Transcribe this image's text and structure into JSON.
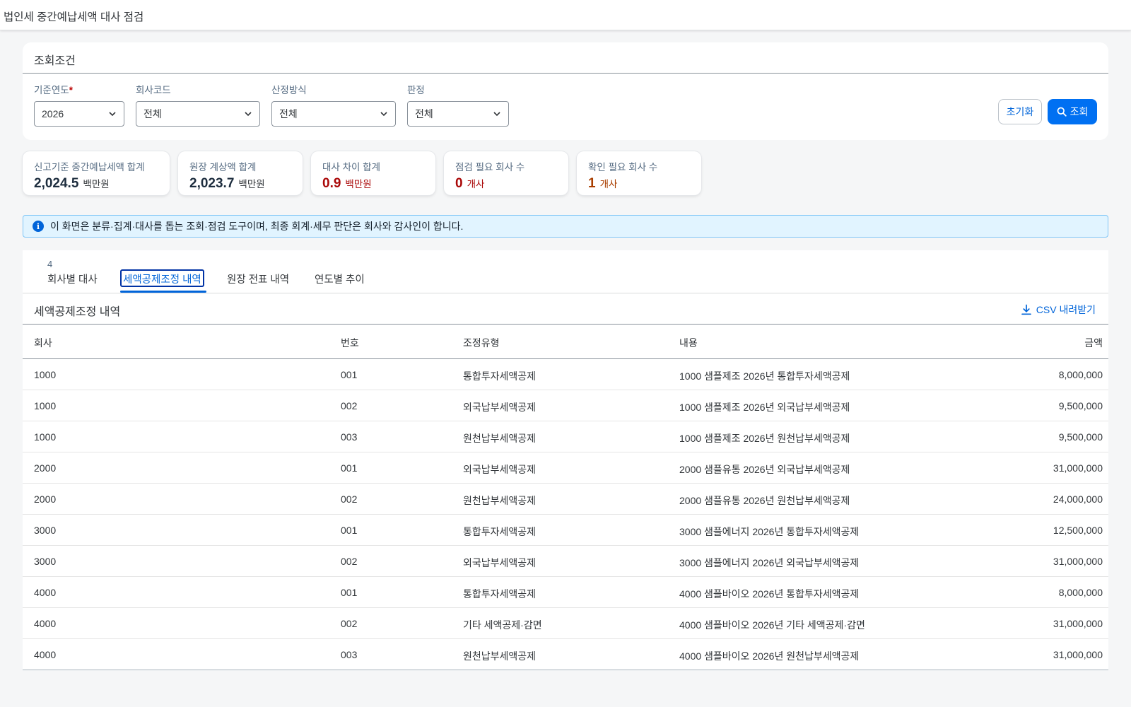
{
  "shell": {
    "title": "법인세 중간예납세액 대사 점검"
  },
  "filters": {
    "header": "조회조건",
    "year": {
      "label": "기준연도",
      "required_mark": "*",
      "value": "2026"
    },
    "company": {
      "label": "회사코드",
      "value": "전체"
    },
    "method": {
      "label": "산정방식",
      "value": "전체"
    },
    "verdict": {
      "label": "판정",
      "value": "전체"
    },
    "reset_label": "초기화",
    "search_label": "조회"
  },
  "kpis": [
    {
      "label": "신고기준 중간예납세액 합계",
      "value": "2,024.5",
      "unit": "백만원"
    },
    {
      "label": "원장 계상액 합계",
      "value": "2,023.7",
      "unit": "백만원"
    },
    {
      "label": "대사 차이 합계",
      "value": "0.9",
      "unit": "백만원"
    },
    {
      "label": "점검 필요 회사 수",
      "value": "0",
      "unit": "개사"
    },
    {
      "label": "확인 필요 회사 수",
      "value": "1",
      "unit": "개사"
    }
  ],
  "notice": "이 화면은 분류·집계·대사를 돕는 조회·점검 도구이며, 최종 회계·세무 판단은 회사와 감사인이 합니다.",
  "tabs": {
    "items": [
      {
        "label": "회사별 대사",
        "count": "4"
      },
      {
        "label": "세액공제조정 내역"
      },
      {
        "label": "원장 전표 내역"
      },
      {
        "label": "연도별 추이"
      }
    ],
    "active": "세액공제조정 내역"
  },
  "table": {
    "title": "세액공제조정 내역",
    "csv_label": "CSV 내려받기",
    "columns": [
      "회사",
      "번호",
      "조정유형",
      "내용",
      "금액"
    ],
    "rows": [
      [
        "1000",
        "001",
        "통합투자세액공제",
        "1000 샘플제조 2026년 통합투자세액공제",
        "8,000,000"
      ],
      [
        "1000",
        "002",
        "외국납부세액공제",
        "1000 샘플제조 2026년 외국납부세액공제",
        "9,500,000"
      ],
      [
        "1000",
        "003",
        "원천납부세액공제",
        "1000 샘플제조 2026년 원천납부세액공제",
        "9,500,000"
      ],
      [
        "2000",
        "001",
        "외국납부세액공제",
        "2000 샘플유통 2026년 외국납부세액공제",
        "31,000,000"
      ],
      [
        "2000",
        "002",
        "원천납부세액공제",
        "2000 샘플유통 2026년 원천납부세액공제",
        "24,000,000"
      ],
      [
        "3000",
        "001",
        "통합투자세액공제",
        "3000 샘플에너지 2026년 통합투자세액공제",
        "12,500,000"
      ],
      [
        "3000",
        "002",
        "외국납부세액공제",
        "3000 샘플에너지 2026년 외국납부세액공제",
        "31,000,000"
      ],
      [
        "4000",
        "001",
        "통합투자세액공제",
        "4000 샘플바이오 2026년 통합투자세액공제",
        "8,000,000"
      ],
      [
        "4000",
        "002",
        "기타 세액공제·감면",
        "4000 샘플바이오 2026년 기타 세액공제·감면",
        "31,000,000"
      ],
      [
        "4000",
        "003",
        "원천납부세액공제",
        "4000 샘플바이오 2026년 원천납부세액공제",
        "31,000,000"
      ]
    ]
  },
  "colors": {
    "accent": "#0070f2",
    "link": "#0064d9",
    "negative": "#aa0808",
    "critical": "#a93e00",
    "info_bg": "#e1f4ff"
  },
  "icons": {
    "select_chevron": "chevron-down-icon",
    "search": "search-icon",
    "info": "info-icon",
    "download": "download-icon"
  }
}
